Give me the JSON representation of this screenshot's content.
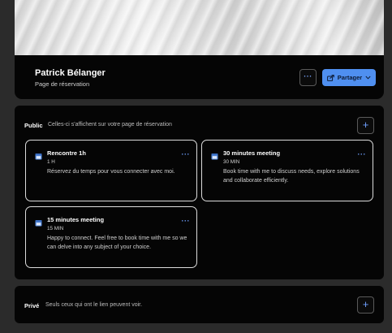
{
  "profile": {
    "name": "Patrick Bélanger",
    "subtitle": "Page de réservation",
    "more_label": "···",
    "share_label": "Partager"
  },
  "public": {
    "title": "Public",
    "description": "Celles-ci s'affichent sur votre page de réservation",
    "add_label": "+",
    "meetings": [
      {
        "title": "Rencontre 1h",
        "duration": "1 H",
        "description": "Réservez du temps pour vous connecter avec moi.",
        "more_label": "···"
      },
      {
        "title": "30 minutes meeting",
        "duration": "30 MIN",
        "description": "Book time with me to discuss needs, explore solutions and collaborate efficiently.",
        "more_label": "···"
      },
      {
        "title": "15 minutes meeting",
        "duration": "15 MIN",
        "description": "Happy to connect. Feel free to book time with me so we can delve into any subject of your choice.",
        "more_label": "···"
      }
    ]
  },
  "private": {
    "title": "Privé",
    "description": "Seuls ceux qui ont le lien peuvent voir.",
    "add_label": "+"
  },
  "colors": {
    "accent": "#4f8ff0",
    "background": "#2b2b2b",
    "panel": "#050505"
  },
  "icons": [
    "share-icon",
    "chevron-down-icon",
    "calendar-icon",
    "more-icon",
    "plus-icon"
  ]
}
